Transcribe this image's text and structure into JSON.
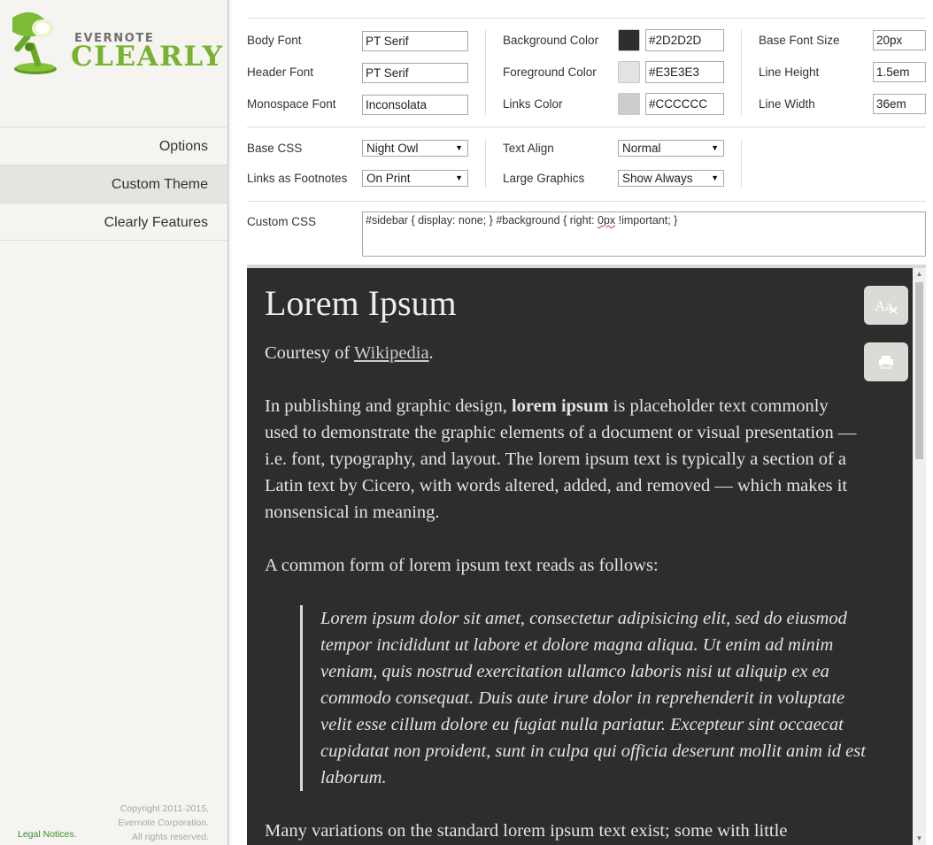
{
  "sidebar": {
    "logo_top": "EVERNOTE",
    "logo_main": "CLEARLY",
    "nav": [
      {
        "label": "Options"
      },
      {
        "label": "Custom Theme"
      },
      {
        "label": "Clearly Features"
      }
    ],
    "copyright_lines": [
      "Copyright 2011-2015,",
      "Evernote Corporation.",
      "All rights reserved."
    ],
    "legal_link": "Legal Notices."
  },
  "theme": {
    "body_font": {
      "label": "Body Font",
      "value": "PT Serif"
    },
    "header_font": {
      "label": "Header Font",
      "value": "PT Serif"
    },
    "mono_font": {
      "label": "Monospace Font",
      "value": "Inconsolata"
    },
    "background_color": {
      "label": "Background Color",
      "value": "#2D2D2D",
      "swatch": "#2d2d2d"
    },
    "foreground_color": {
      "label": "Foreground Color",
      "value": "#E3E3E3",
      "swatch": "#e3e3e3"
    },
    "links_color": {
      "label": "Links Color",
      "value": "#CCCCCC",
      "swatch": "#cccccc"
    },
    "base_font_size": {
      "label": "Base Font Size",
      "value": "20px"
    },
    "line_height": {
      "label": "Line Height",
      "value": "1.5em"
    },
    "line_width": {
      "label": "Line Width",
      "value": "36em"
    },
    "base_css": {
      "label": "Base CSS",
      "value": "Night Owl"
    },
    "links_footnotes": {
      "label": "Links as Footnotes",
      "value": "On Print"
    },
    "text_align": {
      "label": "Text Align",
      "value": "Normal"
    },
    "large_graphics": {
      "label": "Large Graphics",
      "value": "Show Always"
    },
    "custom_css": {
      "label": "Custom CSS",
      "before": "#sidebar { display: none; } #background { right: ",
      "flagged": "0px",
      "after": " !important; }"
    }
  },
  "preview": {
    "title": "Lorem Ipsum",
    "courtesy_prefix": "Courtesy of ",
    "courtesy_link": "Wikipedia",
    "courtesy_suffix": ".",
    "p1_before": "In publishing and graphic design, ",
    "p1_bold": "lorem ipsum",
    "p1_after": " is placeholder text commonly used to demonstrate the graphic elements of a document or visual presentation — i.e. font, typography, and layout. The lorem ipsum text is typically a section of a Latin text by Cicero, with words altered, added, and removed — which makes it nonsensical in meaning.",
    "p2": "A common form of lorem ipsum text reads as follows:",
    "quote": "Lorem ipsum dolor sit amet, consectetur adipisicing elit, sed do eiusmod tempor incididunt ut labore et dolore magna aliqua. Ut enim ad minim veniam, quis nostrud exercitation ullamco laboris nisi ut aliquip ex ea commodo consequat. Duis aute irure dolor in reprehenderit in voluptate velit esse cillum dolore eu fugiat nulla pariatur. Excepteur sint occaecat cupidatat non proident, sunt in culpa qui officia deserunt mollit anim id est laborum.",
    "p3": "Many variations on the standard lorem ipsum text exist; some with little",
    "text_size_icon": "text-size-icon",
    "print_icon": "print-icon"
  }
}
